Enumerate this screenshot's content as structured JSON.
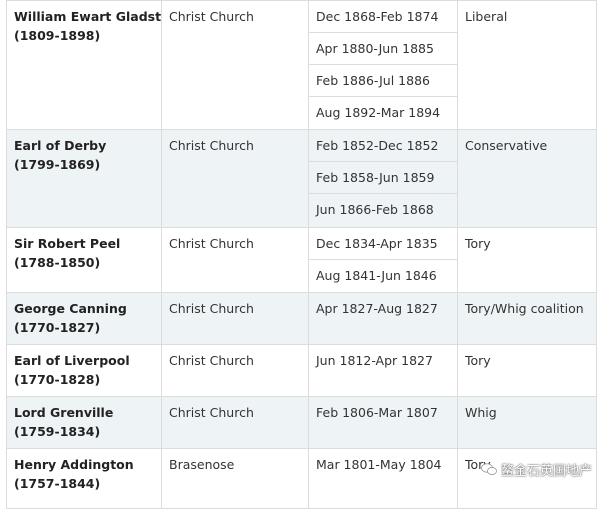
{
  "rows": [
    {
      "name": "William Ewart Gladstone",
      "years": "(1809-1898)",
      "college": "Christ Church",
      "terms": [
        "Dec 1868-Feb 1874",
        "Apr 1880-Jun 1885",
        "Feb 1886-Jul 1886",
        "Aug 1892-Mar 1894"
      ],
      "party": "Liberal"
    },
    {
      "name": "Earl of Derby",
      "years": "(1799-1869)",
      "college": "Christ Church",
      "terms": [
        "Feb 1852-Dec 1852",
        "Feb 1858-Jun 1859",
        "Jun 1866-Feb 1868"
      ],
      "party": "Conservative"
    },
    {
      "name": "Sir Robert Peel",
      "years": "(1788-1850)",
      "college": "Christ Church",
      "terms": [
        "Dec 1834-Apr 1835",
        "Aug 1841-Jun 1846"
      ],
      "party": "Tory"
    },
    {
      "name": "George Canning",
      "years": "(1770-1827)",
      "college": "Christ Church",
      "terms": [
        "Apr 1827-Aug 1827"
      ],
      "party": "Tory/Whig coalition"
    },
    {
      "name": "Earl of Liverpool",
      "years": "(1770-1828)",
      "college": "Christ Church",
      "terms": [
        "Jun 1812-Apr 1827"
      ],
      "party": "Tory"
    },
    {
      "name": "Lord Grenville",
      "years": "(1759-1834)",
      "college": "Christ Church",
      "terms": [
        "Feb 1806-Mar 1807"
      ],
      "party": "Whig"
    },
    {
      "name": "Henry Addington",
      "years": "(1757-1844)",
      "college": "Brasenose",
      "terms": [
        "Mar 1801-May 1804"
      ],
      "party": "Tory"
    }
  ],
  "watermark": {
    "text": "鳌金石英国地产",
    "icon": "chat-bubbles-icon"
  }
}
